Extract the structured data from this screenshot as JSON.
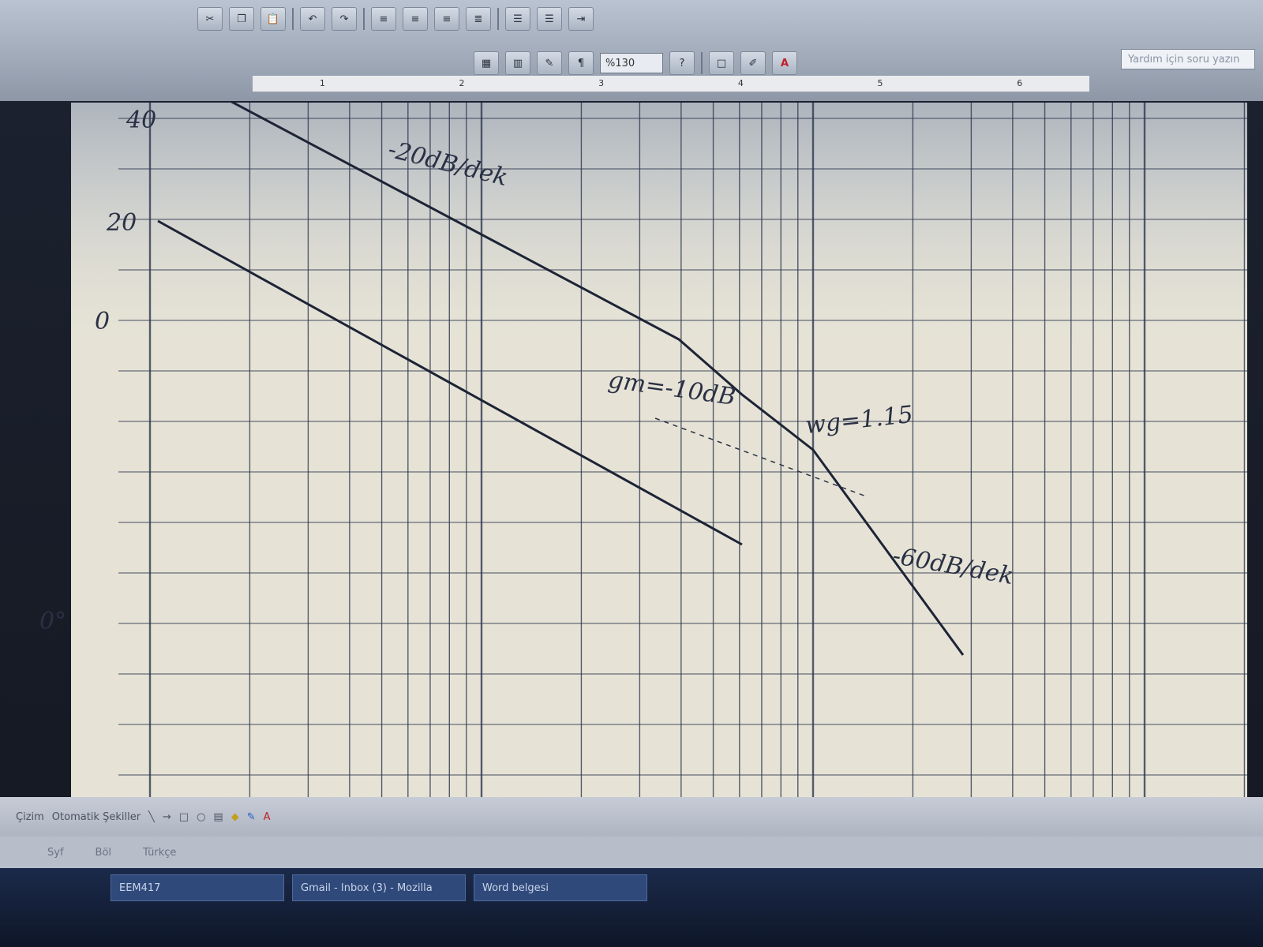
{
  "toolbar": {
    "zoom_value": "%130",
    "help_placeholder": "Yardım için soru yazın"
  },
  "ruler": {
    "ticks": [
      "1",
      "2",
      "3",
      "4",
      "5",
      "6"
    ]
  },
  "graph": {
    "y_labels": [
      "40",
      "20",
      "0",
      "0°"
    ],
    "annotations": {
      "slope_top": "-20dB/dek",
      "gain_margin": "gm=-10dB",
      "wg": "wg=1.15",
      "slope_bottom": "-60dB/dek"
    }
  },
  "drawbar": {
    "draw_label": "Çizim",
    "autoshapes_label": "Otomatik Şekiller"
  },
  "statusbar": {
    "page": "Syf",
    "section": "Böl",
    "lang": "Türkçe"
  },
  "taskbar": {
    "items": [
      "EEM417",
      "Gmail - Inbox (3) - Mozilla",
      "Word belgesi"
    ]
  }
}
